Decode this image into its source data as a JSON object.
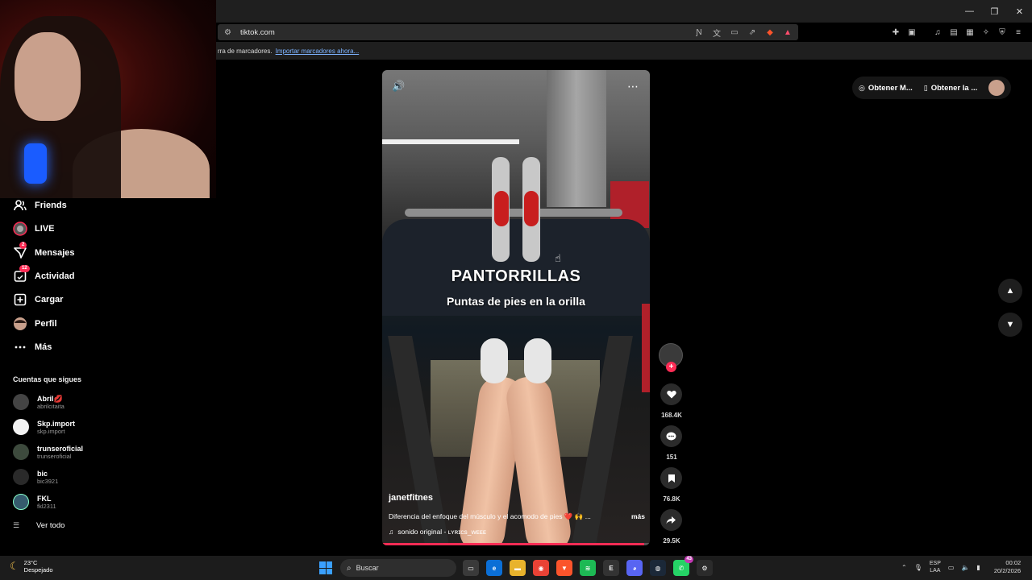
{
  "browser": {
    "url": "tiktok.com",
    "bookmarks_bar_text": "rra de marcadores.",
    "bookmarks_import_link": "Importar marcadores ahora..."
  },
  "sidebar": {
    "items": [
      {
        "label": "Friends",
        "icon": "friends-icon"
      },
      {
        "label": "LIVE",
        "icon": "live-icon"
      },
      {
        "label": "Mensajes",
        "icon": "messages-icon",
        "badge": "2"
      },
      {
        "label": "Actividad",
        "icon": "activity-icon",
        "badge": "12"
      },
      {
        "label": "Cargar",
        "icon": "upload-icon"
      },
      {
        "label": "Perfil",
        "icon": "profile-icon"
      },
      {
        "label": "Más",
        "icon": "more-icon"
      }
    ],
    "following_title": "Cuentas que sigues",
    "following": [
      {
        "name": "Abril💋",
        "handle": "abrilcitaita"
      },
      {
        "name": "Skp.import",
        "handle": "skp.import"
      },
      {
        "name": "trunseroficial",
        "handle": "trunseroficial"
      },
      {
        "name": "bic",
        "handle": "bic3921"
      },
      {
        "name": "FKL",
        "handle": "fkl2311"
      }
    ],
    "see_all": "Ver todo"
  },
  "video": {
    "headline": "PANTORRILLAS",
    "subline": "Puntas de pies en la orilla",
    "author": "janetfitnes",
    "description": "Diferencia del enfoque del músculo y el acomodo de pies ❤️ 🙌 ...",
    "more_label": "más",
    "sound": "sonido original - ʟʏʀɪᴄs_ᴡᴇᴇᴇ",
    "progress": 0.98
  },
  "actions": {
    "likes": "168.4K",
    "comments": "151",
    "saves": "76.8K",
    "shares": "29.5K"
  },
  "right_pills": {
    "pill1": "Obtener M...",
    "pill2": "Obtener la ..."
  },
  "taskbar": {
    "temp": "23°C",
    "weather": "Despejado",
    "search": "Buscar",
    "whatsapp_badge": "43",
    "lang1": "ESP",
    "lang2": "LAA",
    "time": "00:02",
    "date": "20/2/2026"
  }
}
